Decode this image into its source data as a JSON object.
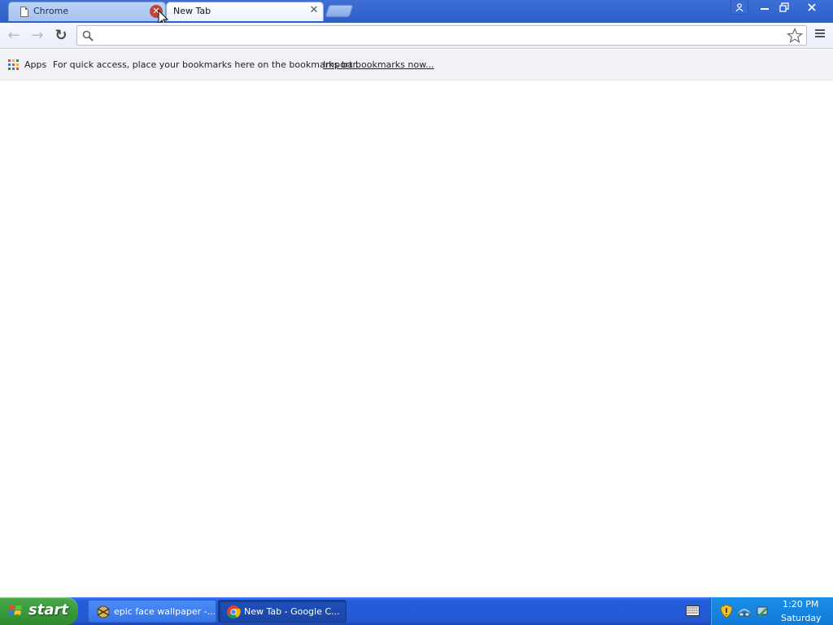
{
  "browser": {
    "tabs": [
      {
        "title": "Chrome",
        "active": false
      },
      {
        "title": "New Tab",
        "active": true
      }
    ],
    "window_controls": {
      "minimize": "—",
      "restore": "❐",
      "close": "X"
    },
    "toolbar": {
      "back": "←",
      "forward": "→",
      "reload": "↻",
      "omnibox_value": "",
      "omnibox_placeholder": ""
    },
    "bookmarks_bar": {
      "apps_label": "Apps",
      "hint": "For quick access, place your bookmarks here on the bookmarks bar.",
      "import_link": "Import bookmarks now..."
    }
  },
  "taskbar": {
    "start_label": "start",
    "items": [
      {
        "label": "epic face wallpaper -...",
        "active": false
      },
      {
        "label": "New Tab - Google C...",
        "active": true
      }
    ],
    "clock": {
      "time": "1:20 PM",
      "day": "Saturday"
    }
  },
  "colors": {
    "tabstrip": "#2d5fc9",
    "taskbar": "#245edb",
    "start_button": "#3c9d3c",
    "tray": "#1a8fe8",
    "tab_close_hover": "#c2453a"
  },
  "icons": {
    "page": "document-icon",
    "search": "search-icon",
    "star": "star-icon",
    "menu": "hamburger-menu-icon",
    "apps": "apps-grid-icon",
    "start": "windows-logo-icon",
    "chrome": "chrome-logo-icon"
  }
}
